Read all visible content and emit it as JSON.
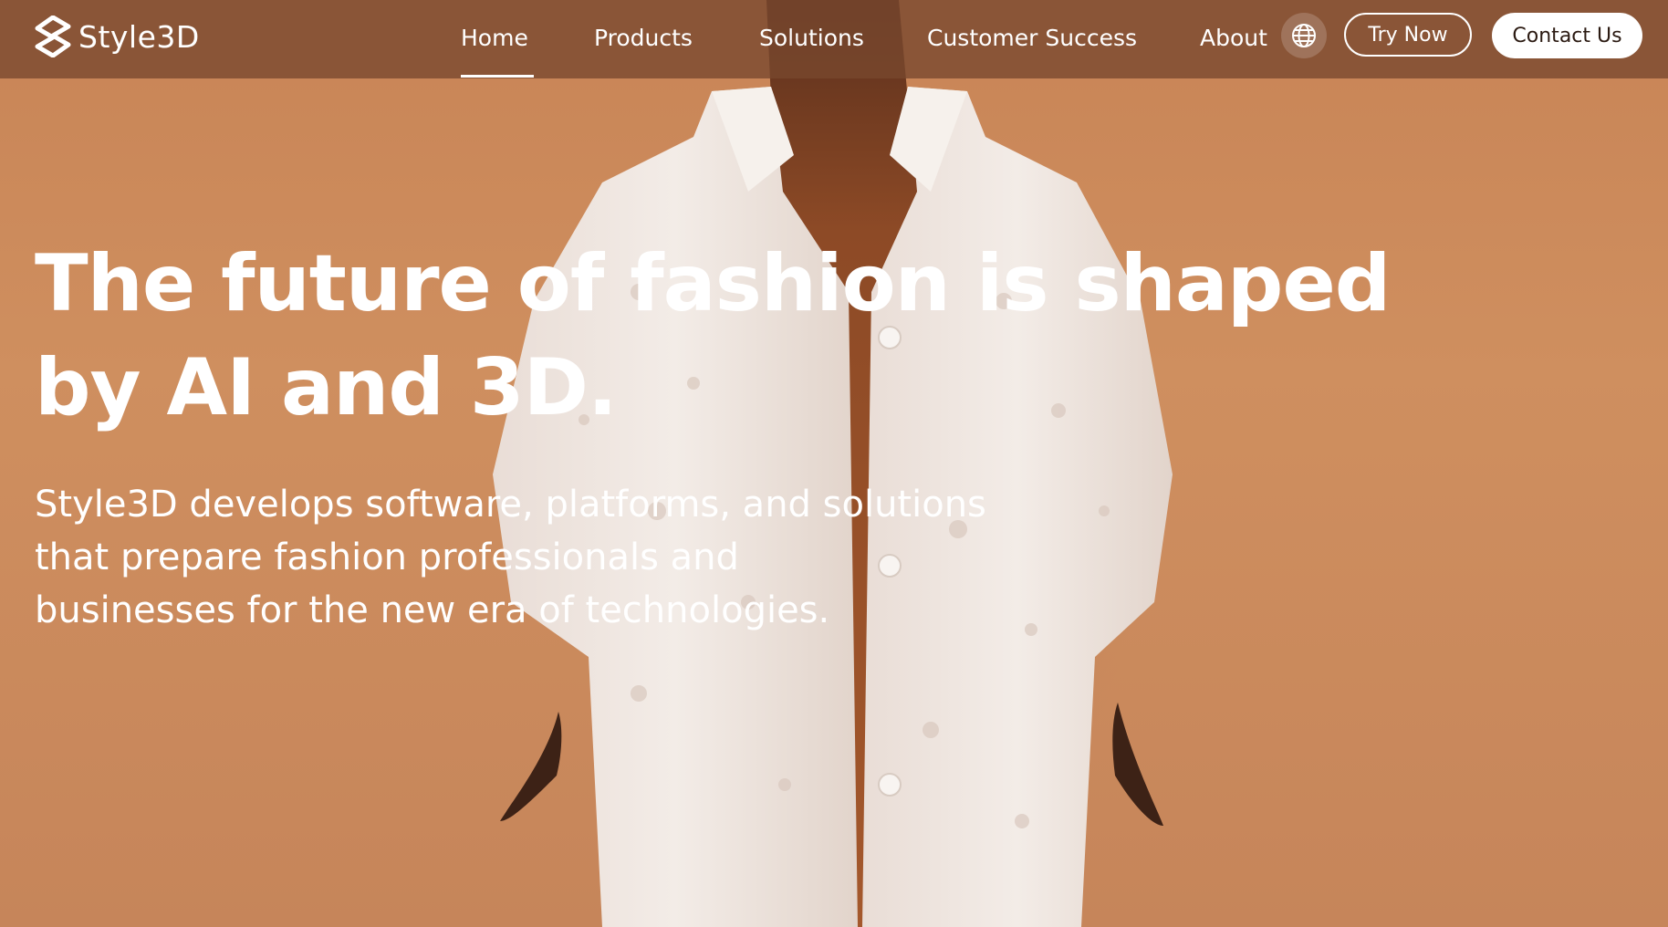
{
  "brand": {
    "name": "Style3D"
  },
  "nav": {
    "items": [
      {
        "label": "Home",
        "active": true
      },
      {
        "label": "Products"
      },
      {
        "label": "Solutions"
      },
      {
        "label": "Customer Success"
      },
      {
        "label": "About"
      }
    ],
    "language_icon": "globe-icon",
    "try_label": "Try Now",
    "contact_label": "Contact Us"
  },
  "hero": {
    "headline_line1": "The future of fashion is shaped",
    "headline_line2": "by AI and 3D.",
    "sub_line1": "Style3D develops software, platforms, and solutions",
    "sub_line2": "that prepare fashion professionals and",
    "sub_line3": "businesses for the new era of technologies."
  },
  "colors": {
    "background": "#c98a5c",
    "navbar": "#78482e",
    "text": "#ffffff",
    "contact_button_text": "#2b1a12"
  }
}
